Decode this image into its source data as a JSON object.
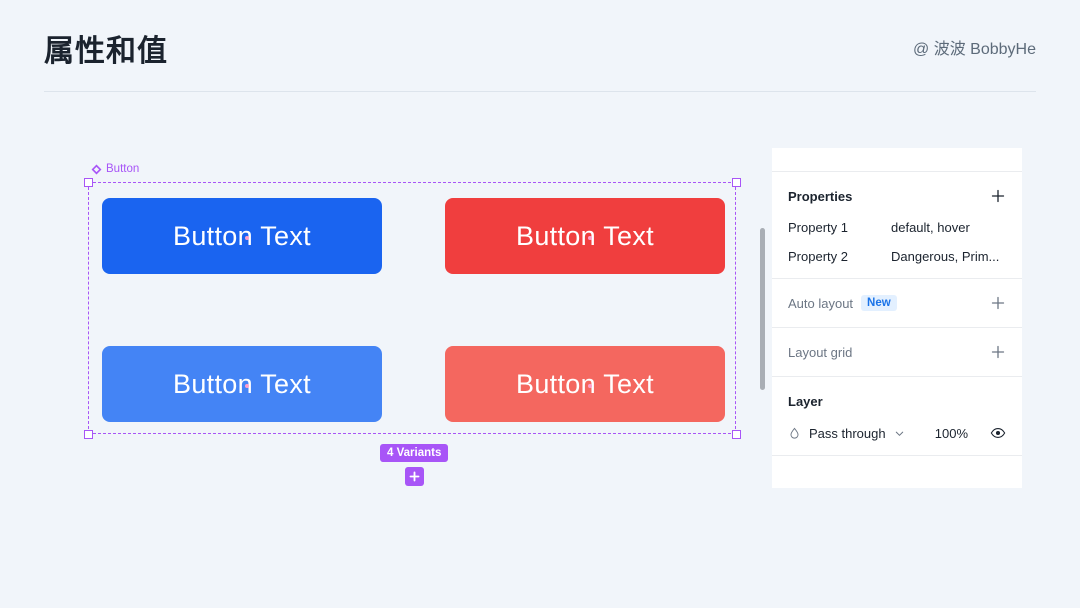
{
  "header": {
    "title": "属性和值",
    "attribution": "@ 波波 BobbyHe"
  },
  "canvas": {
    "selection_label": "Button",
    "component_icon": "component-diamond-icon",
    "variants_badge": "4 Variants",
    "variants_add_icon": "plus-icon",
    "buttons": [
      {
        "label": "Button Text",
        "color": "#1a64f0",
        "row": 0,
        "col": 0
      },
      {
        "label": "Button Text",
        "color": "#f03e3e",
        "row": 0,
        "col": 1
      },
      {
        "label": "Button Text",
        "color": "#4484f5",
        "row": 1,
        "col": 0
      },
      {
        "label": "Button Text",
        "color": "#f4675f",
        "row": 1,
        "col": 1
      }
    ]
  },
  "panel": {
    "properties": {
      "title": "Properties",
      "add_icon": "plus-icon",
      "rows": [
        {
          "name": "Property 1",
          "value": "default, hover"
        },
        {
          "name": "Property 2",
          "value": "Dangerous, Prim..."
        }
      ]
    },
    "auto_layout": {
      "title": "Auto layout",
      "badge": "New",
      "add_icon": "plus-icon"
    },
    "layout_grid": {
      "title": "Layout grid",
      "add_icon": "plus-icon"
    },
    "layer": {
      "title": "Layer",
      "blend_icon": "blend-mode-icon",
      "blend_mode": "Pass through",
      "chevron_icon": "chevron-down-icon",
      "opacity": "100%",
      "visibility_icon": "eye-icon"
    }
  },
  "colors": {
    "background": "#f1f5fa",
    "selection": "#a855f7",
    "accent_blue": "#1a73e8"
  }
}
